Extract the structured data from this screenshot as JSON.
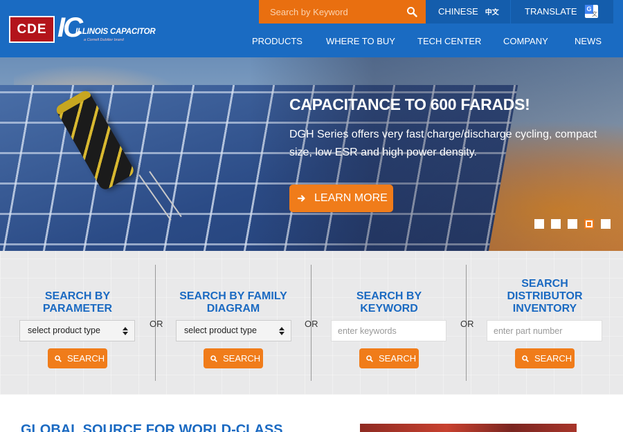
{
  "header": {
    "logo": {
      "brand": "CDE",
      "mark": "IC",
      "name": "ILLINOIS CAPACITOR",
      "sub": "a Cornell Dubilier brand"
    },
    "search_placeholder": "Search by Keyword",
    "chinese_label": "CHINESE",
    "chinese_glyph": "中文",
    "translate_label": "TRANSLATE",
    "nav": [
      "PRODUCTS",
      "WHERE TO BUY",
      "TECH CENTER",
      "COMPANY",
      "NEWS"
    ]
  },
  "hero": {
    "title": "CAPACITANCE TO 600 FARADS!",
    "text": "DGH Series offers very fast charge/discharge cycling, compact size, low ESR and high power density.",
    "button": "LEARN MORE",
    "slide_count": 5,
    "active_slide": 4
  },
  "search": {
    "columns": [
      {
        "title": "SEARCH BY PARAMETER",
        "type": "select",
        "value": "select product type",
        "button": "SEARCH"
      },
      {
        "title": "SEARCH BY FAMILY DIAGRAM",
        "type": "select",
        "value": "select product type",
        "button": "SEARCH"
      },
      {
        "title": "SEARCH BY KEYWORD",
        "type": "input",
        "placeholder": "enter keywords",
        "button": "SEARCH"
      },
      {
        "title": "SEARCH DISTRIBUTOR INVENTORY",
        "type": "input",
        "placeholder": "enter part number",
        "button": "SEARCH"
      }
    ],
    "or_label": "OR"
  },
  "bottom": {
    "title": "GLOBAL SOURCE FOR WORLD-CLASS"
  },
  "colors": {
    "header_blue": "#1a6bc2",
    "accent_orange": "#f07c1a",
    "title_blue": "#1b6ac2"
  }
}
